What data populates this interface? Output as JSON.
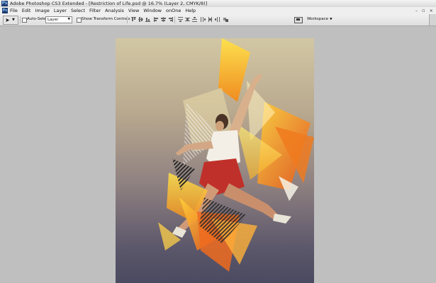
{
  "window": {
    "app_icon": "Ps",
    "title": "Adobe Photoshop CS3 Extended - [Restriction of Life.psd @ 16.7% (Layer 2, CMYK/8)]"
  },
  "menubar": {
    "app_icon": "Ps",
    "items": [
      "File",
      "Edit",
      "Image",
      "Layer",
      "Select",
      "Filter",
      "Analysis",
      "View",
      "Window",
      "onOne",
      "Help"
    ],
    "window_controls": [
      "–",
      "▫",
      "×"
    ]
  },
  "options": {
    "auto_select_label": "Auto-Select:",
    "auto_select_value": "Layer",
    "show_transform_label": "Show Transform Controls",
    "workspace_label": "Workspace"
  },
  "canvas": {
    "document_name": "Restriction of Life.psd",
    "zoom": "16.7%",
    "layer": "Layer 2",
    "mode": "CMYK/8"
  }
}
